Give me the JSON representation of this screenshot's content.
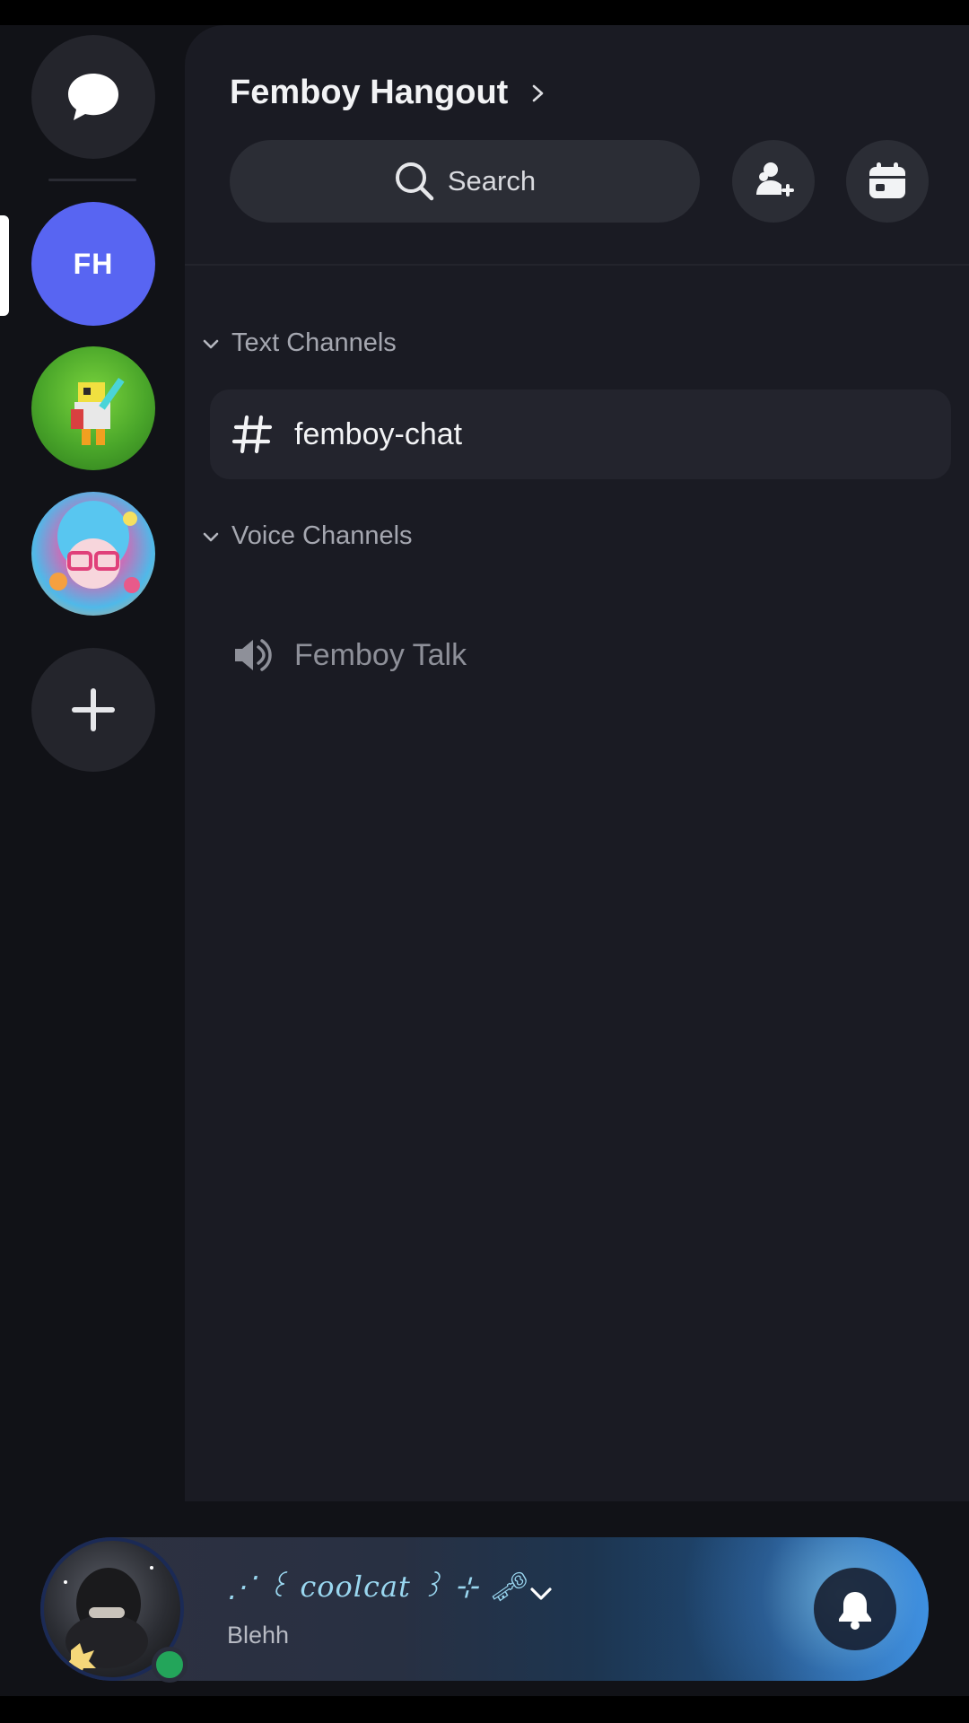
{
  "server": {
    "name": "Femboy Hangout",
    "initials": "FH"
  },
  "search": {
    "label": "Search"
  },
  "categories": [
    {
      "label": "Text Channels",
      "channels": [
        {
          "name": "femboy-chat",
          "type": "text"
        }
      ]
    },
    {
      "label": "Voice Channels",
      "channels": [
        {
          "name": "Femboy Talk",
          "type": "voice"
        }
      ]
    }
  ],
  "user": {
    "display_name": "⋰ ꒰ coolcat ꒱ ⊹ 🗝",
    "status_text": "Blehh",
    "presence": "online"
  },
  "colors": {
    "accent": "#5865f2",
    "online": "#23a55a",
    "background": "#111217",
    "panel": "#1a1b23"
  }
}
